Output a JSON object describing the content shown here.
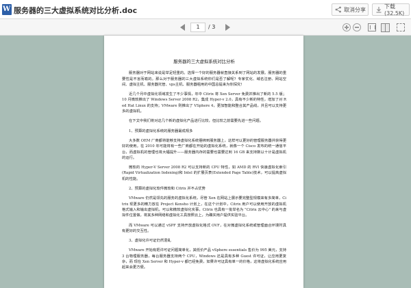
{
  "titlebar": {
    "doc_icon_letter": "W",
    "title": "服务器的三大虚拟系统对比分析.doc",
    "cancel_share": "取消分享",
    "download": "下载(32.5K)"
  },
  "toolbar": {
    "current_page": "1",
    "total_pages": "/ 3"
  },
  "document": {
    "heading": "服务器的三大虚拟系统对比分析",
    "paragraphs": [
      "服务器对于网站来说是举足轻重的。选择一个好的服务器就直接关系到了网站的发展。服务器的重要性是不言而喻的。那么对于服务器的三大虚拟系统你们是否了解呢？专家优化、域名注册、网站空间、虚拟主机、服务器托管、vps主机、服务器租用的中国总提来为你探究！",
      "近几个月中虚拟化领域发生了不少事情，年中 Citrix 将 Xen Server 免费并推出了新的 5.5 版；10 月微软推出了 Windows Server 2008 R2，集成 Hyper-v 2.0，具有不少新的特性，增加了对 Red Hat Linux 的支持；VMware 则推出了 VSphere 4，更加智能和整合其产品线，并且可以支持更多的虚拟机。",
      "在下文中我们将对这几个新的虚拟化产品进行比较，但比较之前需要先进一些问题。"
    ],
    "section1": "1、预算的虚拟化系统的服务器最成规多",
    "paragraphs2": [
      "大多数 OEM 厂商都将能够支持虚拟化系统捆绑到服务器上，这样可以更好的管理服务器并获得更好的使用。在 2010 年可能将有一些厂商都在开始的虚拟化系统，就像一个 Cisco 发布的统一通信平台，而虚拟机的管理也将大幅提升——服务器内存的需要也需要达到 16 GB 来支持数以十计是虚拟机的运行。",
      "微软的 Hyper-V Server 2008 R2 可以支持新的 CPU 特性，如 AMD 的 RVI 快速虚拟化索引(Rapid Virtualization Indexing)和 Intel 的扩展页表(Extended Page Table)技术，可以提高虚拟机的性能。"
    ],
    "section2": "2、预算的虚拟化软件微软和 Citrix 并不占优势",
    "paragraphs3": [
      "VMware 仍然是领先的服务的虚拟化系统，尽管 Xen 在网站上展示要完整型规模来有多简单，Citrix 现更多的精力放在 Project Kensho 计划上，在这个计划中，Citrix 用户可以使用开放的虚拟机格式输入和输出虚拟机，可以和微软虚拟化实事，Citrix 也具有一批举名为 \"Citrix 云中心\" 的来与虚拟件位置做，将其多种网络和虚拟化工具按照云上，为确实用户提供实验平台。",
      "而 VMware 可以通过 vSPF 支持开放虚拟化格式 OVF，在对微虚拟化系统或管理面合环境时具有更好的交互性。"
    ],
    "section3": "3、虚拟化许可证仍然混乱",
    "paragraphs4": [
      "VMware 开始有把许可证问题简单化，其低价产品 vSphere essentials 售价为 995 美元，支持 3 台物理服务器，每台服务器支持两个 CPU，Windows 还是具有多种 Guest 许可证，让应用更复杂，而 现在 Xen Server 和 Hyper-v 都已经免费，如果许可证具有单一的价格，这将虚拟化系统应用起来会更方便。"
    ]
  }
}
